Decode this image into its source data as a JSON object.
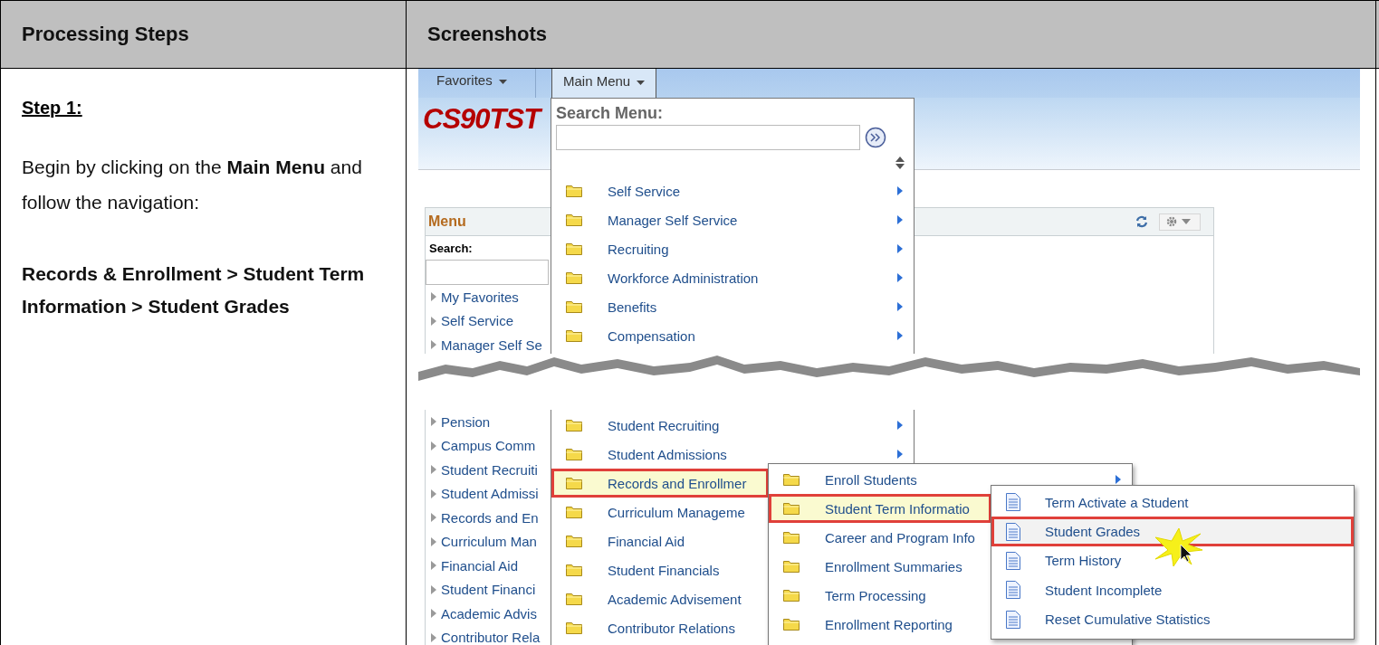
{
  "table": {
    "columns": [
      "Processing Steps",
      "Screenshots"
    ]
  },
  "step": {
    "heading": "Step 1:",
    "instruction": "Begin by clicking on the **Main Menu** and follow the navigation:",
    "navigation_path": "Records & Enrollment > Student Term Information > Student Grades"
  },
  "screenshot": {
    "nav_tabs": [
      {
        "label": "Favorites",
        "selected": false
      },
      {
        "label": "Main Menu",
        "selected": true
      }
    ],
    "site_name": "CS90TST",
    "menu_panel": {
      "title": "Menu",
      "search_label": "Search:",
      "items_top": [
        "My Favorites",
        "Self Service",
        "Manager Self Se"
      ],
      "items_bottom": [
        "Pension",
        "Campus Comm",
        "Student Recruiti",
        "Student Admissi",
        "Records and En",
        "Curriculum Man",
        "Financial Aid",
        "Student Financi",
        "Academic Advis",
        "Contributor Rela"
      ]
    },
    "main_menu": {
      "search_label": "Search Menu:",
      "items_top": [
        {
          "label": "Self Service",
          "arrow": true
        },
        {
          "label": "Manager Self Service",
          "arrow": true
        },
        {
          "label": "Recruiting",
          "arrow": true
        },
        {
          "label": "Workforce Administration",
          "arrow": true
        },
        {
          "label": "Benefits",
          "arrow": true
        },
        {
          "label": "Compensation",
          "arrow": true
        }
      ],
      "items_bottom": [
        {
          "label": "Student Recruiting",
          "arrow": true,
          "selected": false
        },
        {
          "label": "Student Admissions",
          "arrow": true,
          "selected": false
        },
        {
          "label": "Records and Enrollmer",
          "arrow": false,
          "selected": true
        },
        {
          "label": "Curriculum Manageme",
          "arrow": false,
          "selected": false
        },
        {
          "label": "Financial Aid",
          "arrow": false,
          "selected": false
        },
        {
          "label": "Student Financials",
          "arrow": false,
          "selected": false
        },
        {
          "label": "Academic Advisement",
          "arrow": false,
          "selected": false
        },
        {
          "label": "Contributor Relations",
          "arrow": false,
          "selected": false
        }
      ]
    },
    "submenu": {
      "items": [
        {
          "label": "Enroll Students",
          "arrow": true,
          "selected": false
        },
        {
          "label": "Student Term Informatio",
          "arrow": false,
          "selected": true
        },
        {
          "label": "Career and Program Info",
          "arrow": false,
          "selected": false
        },
        {
          "label": "Enrollment Summaries",
          "arrow": false,
          "selected": false
        },
        {
          "label": "Term Processing",
          "arrow": false,
          "selected": false
        },
        {
          "label": "Enrollment Reporting",
          "arrow": false,
          "selected": false
        }
      ]
    },
    "page_menu": {
      "items": [
        {
          "label": "Term Activate a Student",
          "selected": false
        },
        {
          "label": "Student Grades",
          "selected": true
        },
        {
          "label": "Term History",
          "selected": false
        },
        {
          "label": "Student Incomplete",
          "selected": false
        },
        {
          "label": "Reset Cumulative Statistics",
          "selected": false
        }
      ]
    }
  }
}
